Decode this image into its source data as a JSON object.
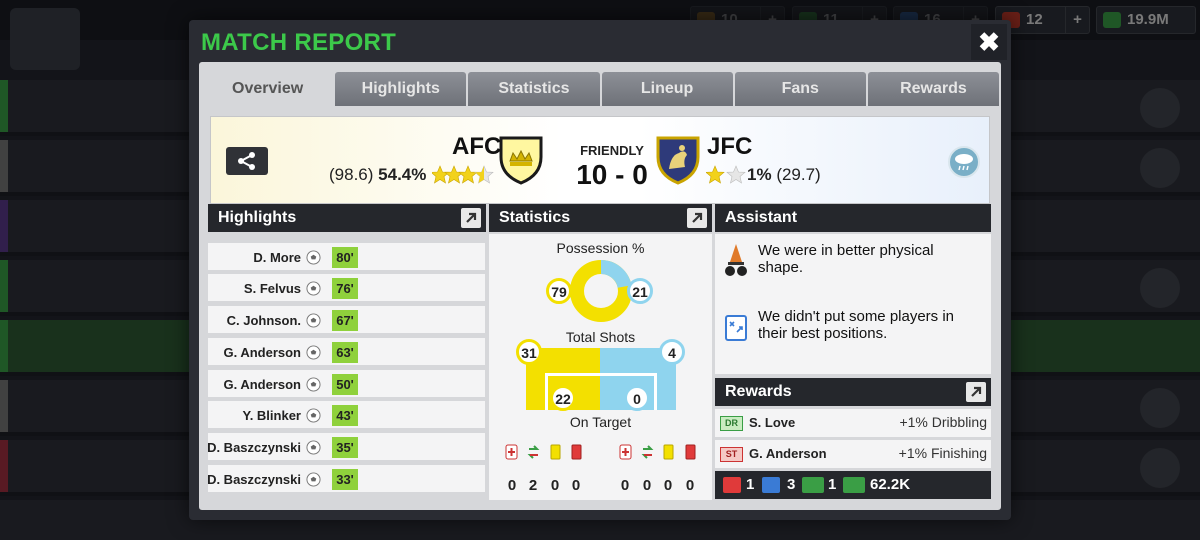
{
  "dialog": {
    "title": "MATCH REPORT",
    "close_label": "✖"
  },
  "top_resources": {
    "r1": "10",
    "r2": "11",
    "r3": "16",
    "r4": "12",
    "money": "19.9M",
    "plus": "+"
  },
  "tabs": [
    "Overview",
    "Highlights",
    "Statistics",
    "Lineup",
    "Fans",
    "Rewards"
  ],
  "match": {
    "home_name": "AFC",
    "home_rating": "(98.6)",
    "home_pct": "54.4%",
    "away_name": "JFC",
    "away_pct": "1%",
    "away_rating": "(29.7)",
    "type": "FRIENDLY",
    "score": "10 - 0"
  },
  "highlights": {
    "title": "Highlights",
    "events": [
      {
        "player": "D. More",
        "minute": "80'"
      },
      {
        "player": "S. Felvus",
        "minute": "76'"
      },
      {
        "player": "C. Johnson.",
        "minute": "67'"
      },
      {
        "player": "G. Anderson",
        "minute": "63'"
      },
      {
        "player": "G. Anderson",
        "minute": "50'"
      },
      {
        "player": "Y. Blinker",
        "minute": "43'"
      },
      {
        "player": "D. Baszczynski",
        "minute": "35'"
      },
      {
        "player": "D. Baszczynski",
        "minute": "33'"
      }
    ]
  },
  "statistics": {
    "title": "Statistics",
    "possession_label": "Possession %",
    "possession_home": "79",
    "possession_away": "21",
    "shots_label": "Total Shots",
    "shots_home": "31",
    "shots_away": "4",
    "on_target_label": "On Target",
    "on_target_home": "22",
    "on_target_away": "0",
    "home_cards": [
      "0",
      "2",
      "0",
      "0"
    ],
    "away_cards": [
      "0",
      "0",
      "0",
      "0"
    ]
  },
  "assistant": {
    "title": "Assistant",
    "tip1": "We were in better physical shape.",
    "tip2": "We didn't put some players in their best positions."
  },
  "rewards": {
    "title": "Rewards",
    "items": [
      {
        "pos": "DR",
        "player": "S. Love",
        "bonus": "+1% Dribbling"
      },
      {
        "pos": "ST",
        "player": "G. Anderson",
        "bonus": "+1% Finishing"
      }
    ],
    "totals": {
      "medical": "1",
      "energy": "3",
      "cash_small": "1",
      "money": "62.2K"
    }
  },
  "colors": {
    "title_green": "#3cc94a",
    "home_yellow": "#f3e000",
    "away_blue": "#8fd4ee",
    "minute_green": "#8fd13c"
  }
}
